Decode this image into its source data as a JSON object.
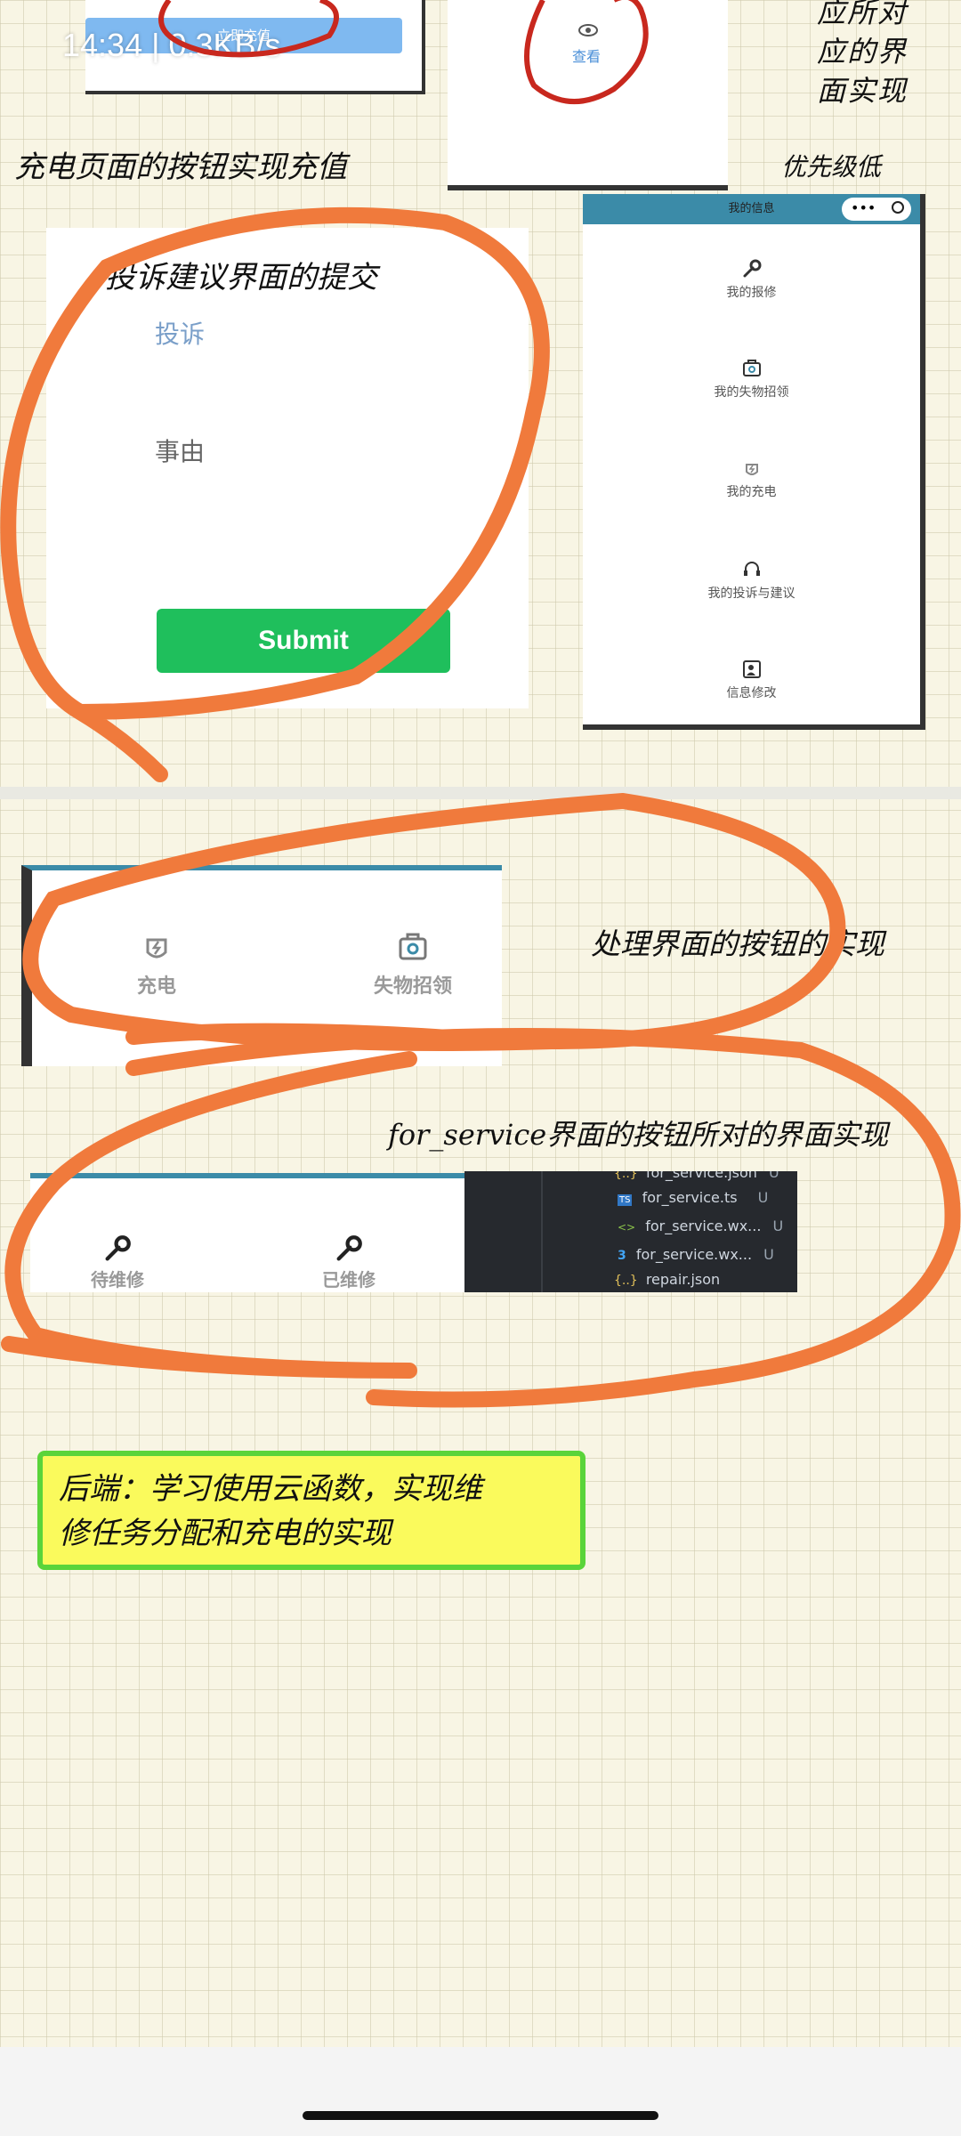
{
  "status_bar": {
    "time_text": "14:34 | 0.3KB/s"
  },
  "top_left_card": {
    "button_label": "立即充值"
  },
  "top_middle_card": {
    "view_label": "查看"
  },
  "top_right_note": {
    "text": "应所对\n应的界\n面实现"
  },
  "note_charge_button": "充电页面的按钮实现充值",
  "note_priority": "优先级低",
  "complaint_card": {
    "note": "投诉建议界面的提交",
    "tab_label": "投诉",
    "reason_label": "事由",
    "submit_label": "Submit"
  },
  "my_info_card": {
    "title": "我的信息",
    "items": [
      {
        "label": "我的报修",
        "icon": "wrench-icon"
      },
      {
        "label": "我的失物招领",
        "icon": "lost-found-icon"
      },
      {
        "label": "我的充电",
        "icon": "charge-icon"
      },
      {
        "label": "我的投诉与建议",
        "icon": "headset-icon"
      },
      {
        "label": "信息修改",
        "icon": "profile-edit-icon"
      }
    ]
  },
  "handling_card": {
    "items": [
      {
        "label": "充电",
        "icon": "charge-icon"
      },
      {
        "label": "失物招领",
        "icon": "lost-found-icon"
      }
    ],
    "note": "处理界面的按钮的实现"
  },
  "for_service_note": "for_service界面的按钮所对的界面实现",
  "service_card": {
    "items": [
      {
        "label": "待维修",
        "icon": "wrench-icon"
      },
      {
        "label": "已维修",
        "icon": "wrench-icon"
      }
    ]
  },
  "file_list": [
    {
      "name": "for_service.json",
      "badge": "U",
      "icon": "{..}"
    },
    {
      "name": "for_service.ts",
      "badge": "U",
      "icon": "TS"
    },
    {
      "name": "for_service.wx...",
      "badge": "U",
      "icon": "<>"
    },
    {
      "name": "for_service.wx...",
      "badge": "U",
      "icon": "3"
    },
    {
      "name": "repair.json",
      "badge": "",
      "icon": "{..}"
    }
  ],
  "backend_note": "后端：学习使用云函数，实现维\n修任务分配和充电的实现",
  "colors": {
    "annotation_orange": "#f07a3c",
    "annotation_red": "#c8281e",
    "submit_green": "#1fbf5c",
    "tab_blue": "#3b8ba8",
    "note_yellow": "#fafa5c",
    "note_border_green": "#5ad43a"
  }
}
